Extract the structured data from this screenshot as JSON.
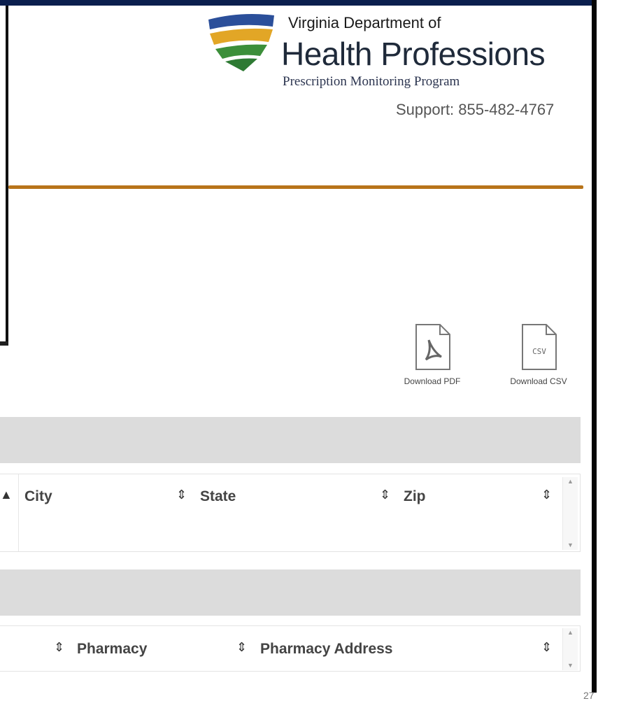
{
  "header": {
    "org_line1": "Virginia Department of",
    "org_line2": "Health Professions",
    "org_line3": "Prescription Monitoring Program",
    "support": "Support: 855-482-4767"
  },
  "downloads": {
    "pdf_label": "Download PDF",
    "csv_label": "Download CSV",
    "csv_glyph": "CSV"
  },
  "table1": {
    "columns": [
      "City",
      "State",
      "Zip"
    ]
  },
  "table2": {
    "columns": [
      "Pharmacy",
      "Pharmacy Address"
    ]
  },
  "footer": {
    "page_number": "27"
  },
  "colors": {
    "top_bar": "#0b1f4e",
    "divider": "#b8741a",
    "band": "#dcdcdc",
    "logo_blue": "#2b4f9a",
    "logo_gold": "#e2a626",
    "logo_green": "#3c8f3a"
  },
  "icons": [
    "shield-logo-icon",
    "pdf-file-icon",
    "csv-file-icon",
    "sort-icon"
  ]
}
